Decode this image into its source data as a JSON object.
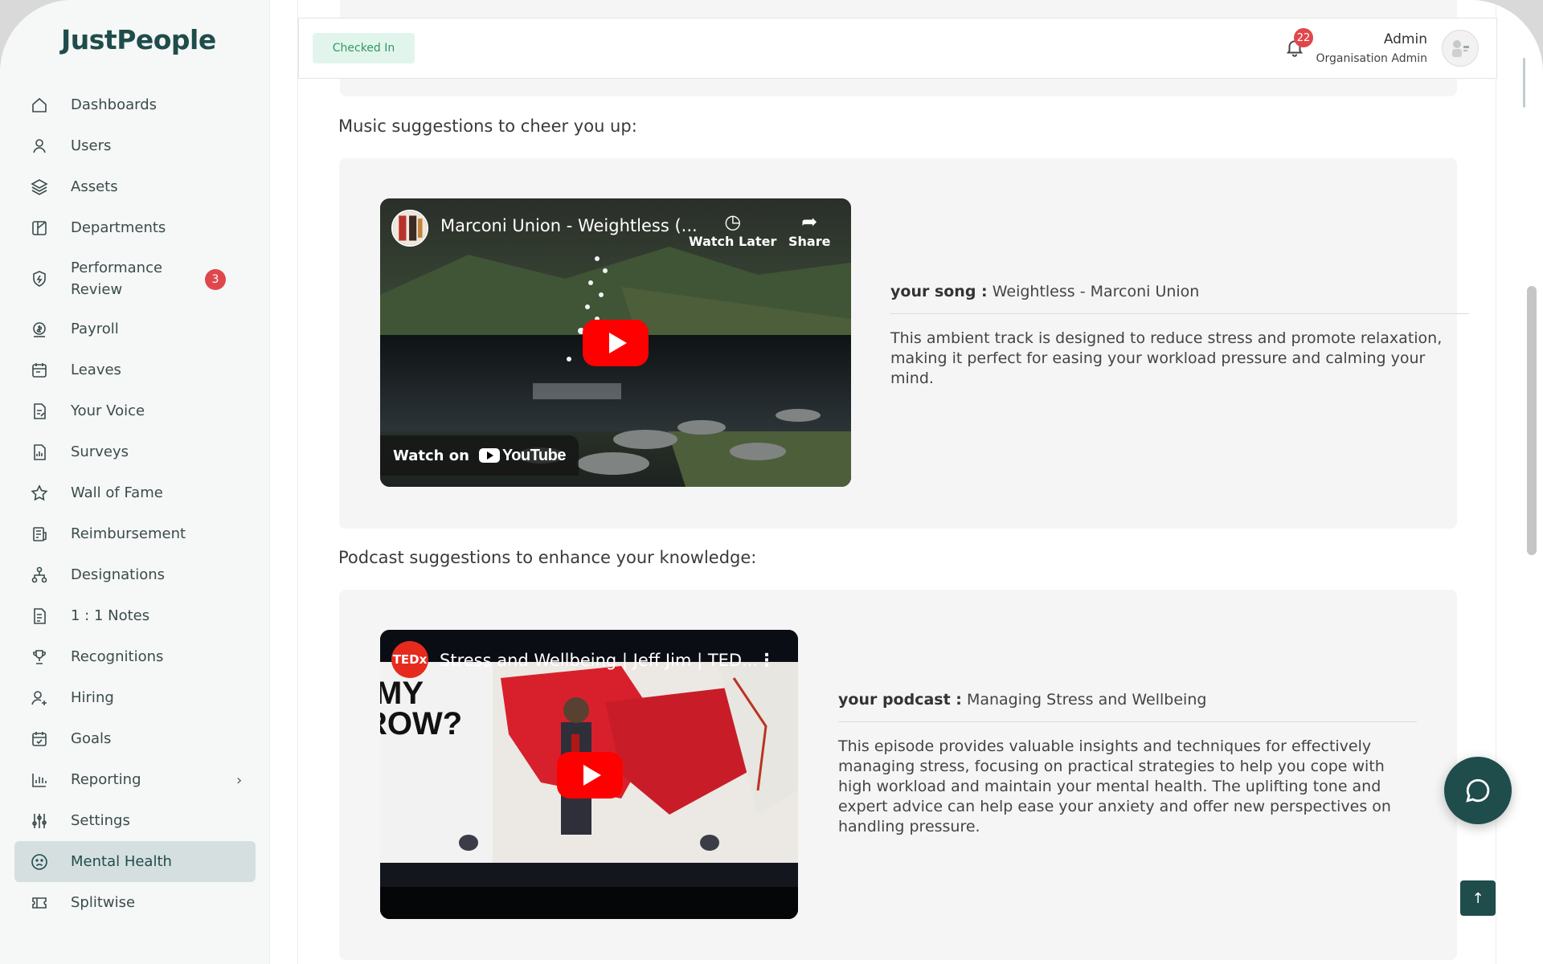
{
  "app": {
    "name": "JustPeople"
  },
  "sidebar": {
    "items": [
      {
        "label": "Dashboards",
        "icon": "home-icon"
      },
      {
        "label": "Users",
        "icon": "user-icon"
      },
      {
        "label": "Assets",
        "icon": "layers-icon"
      },
      {
        "label": "Departments",
        "icon": "department-icon"
      },
      {
        "label": "Performance Review",
        "icon": "shield-icon",
        "badge": "3"
      },
      {
        "label": "Payroll",
        "icon": "payroll-icon"
      },
      {
        "label": "Leaves",
        "icon": "calendar-icon"
      },
      {
        "label": "Your Voice",
        "icon": "document-edit-icon"
      },
      {
        "label": "Surveys",
        "icon": "survey-icon"
      },
      {
        "label": "Wall of Fame",
        "icon": "star-icon"
      },
      {
        "label": "Reimbursement",
        "icon": "receipt-icon"
      },
      {
        "label": "Designations",
        "icon": "hierarchy-icon"
      },
      {
        "label": "1 : 1 Notes",
        "icon": "notes-icon"
      },
      {
        "label": "Recognitions",
        "icon": "trophy-icon"
      },
      {
        "label": "Hiring",
        "icon": "user-add-icon"
      },
      {
        "label": "Goals",
        "icon": "goals-icon"
      },
      {
        "label": "Reporting",
        "icon": "chart-icon"
      },
      {
        "label": "Settings",
        "icon": "sliders-icon"
      },
      {
        "label": "Mental Health",
        "icon": "face-icon",
        "active": true
      },
      {
        "label": "Splitwise",
        "icon": "ticket-icon"
      }
    ]
  },
  "header": {
    "status": "Checked In",
    "notifications": "22",
    "user_name": "Admin",
    "user_role": "Organisation Admin"
  },
  "music": {
    "section_title": "Music suggestions to cheer you up:",
    "video_title": "Marconi Union - Weightless (...",
    "watch_later": "Watch Later",
    "share": "Share",
    "watch_on": "Watch on",
    "youtube": "YouTube",
    "label": "your song :",
    "value": "Weightless - Marconi Union",
    "description": "This ambient track is designed to reduce stress and promote relaxation, making it perfect for easing your workload pressure and calming your mind."
  },
  "podcast": {
    "section_title": "Podcast suggestions to enhance your knowledge:",
    "video_title": "Stress and Wellbeing | Jeff Jim | TED...",
    "channel": "TEDx",
    "label": "your podcast :",
    "value": "Managing Stress and Wellbeing",
    "description": "This episode provides valuable insights and techniques for effectively managing stress, focusing on practical strategies to help you cope with high workload and maintain your mental health. The uplifting tone and expert advice can help ease your anxiety and offer new perspectives on handling pressure."
  },
  "colors": {
    "brand": "#1e4d4b",
    "badge": "#e0474c",
    "checked_in_bg": "#e2f5ec",
    "checked_in_text": "#2e9a62"
  }
}
